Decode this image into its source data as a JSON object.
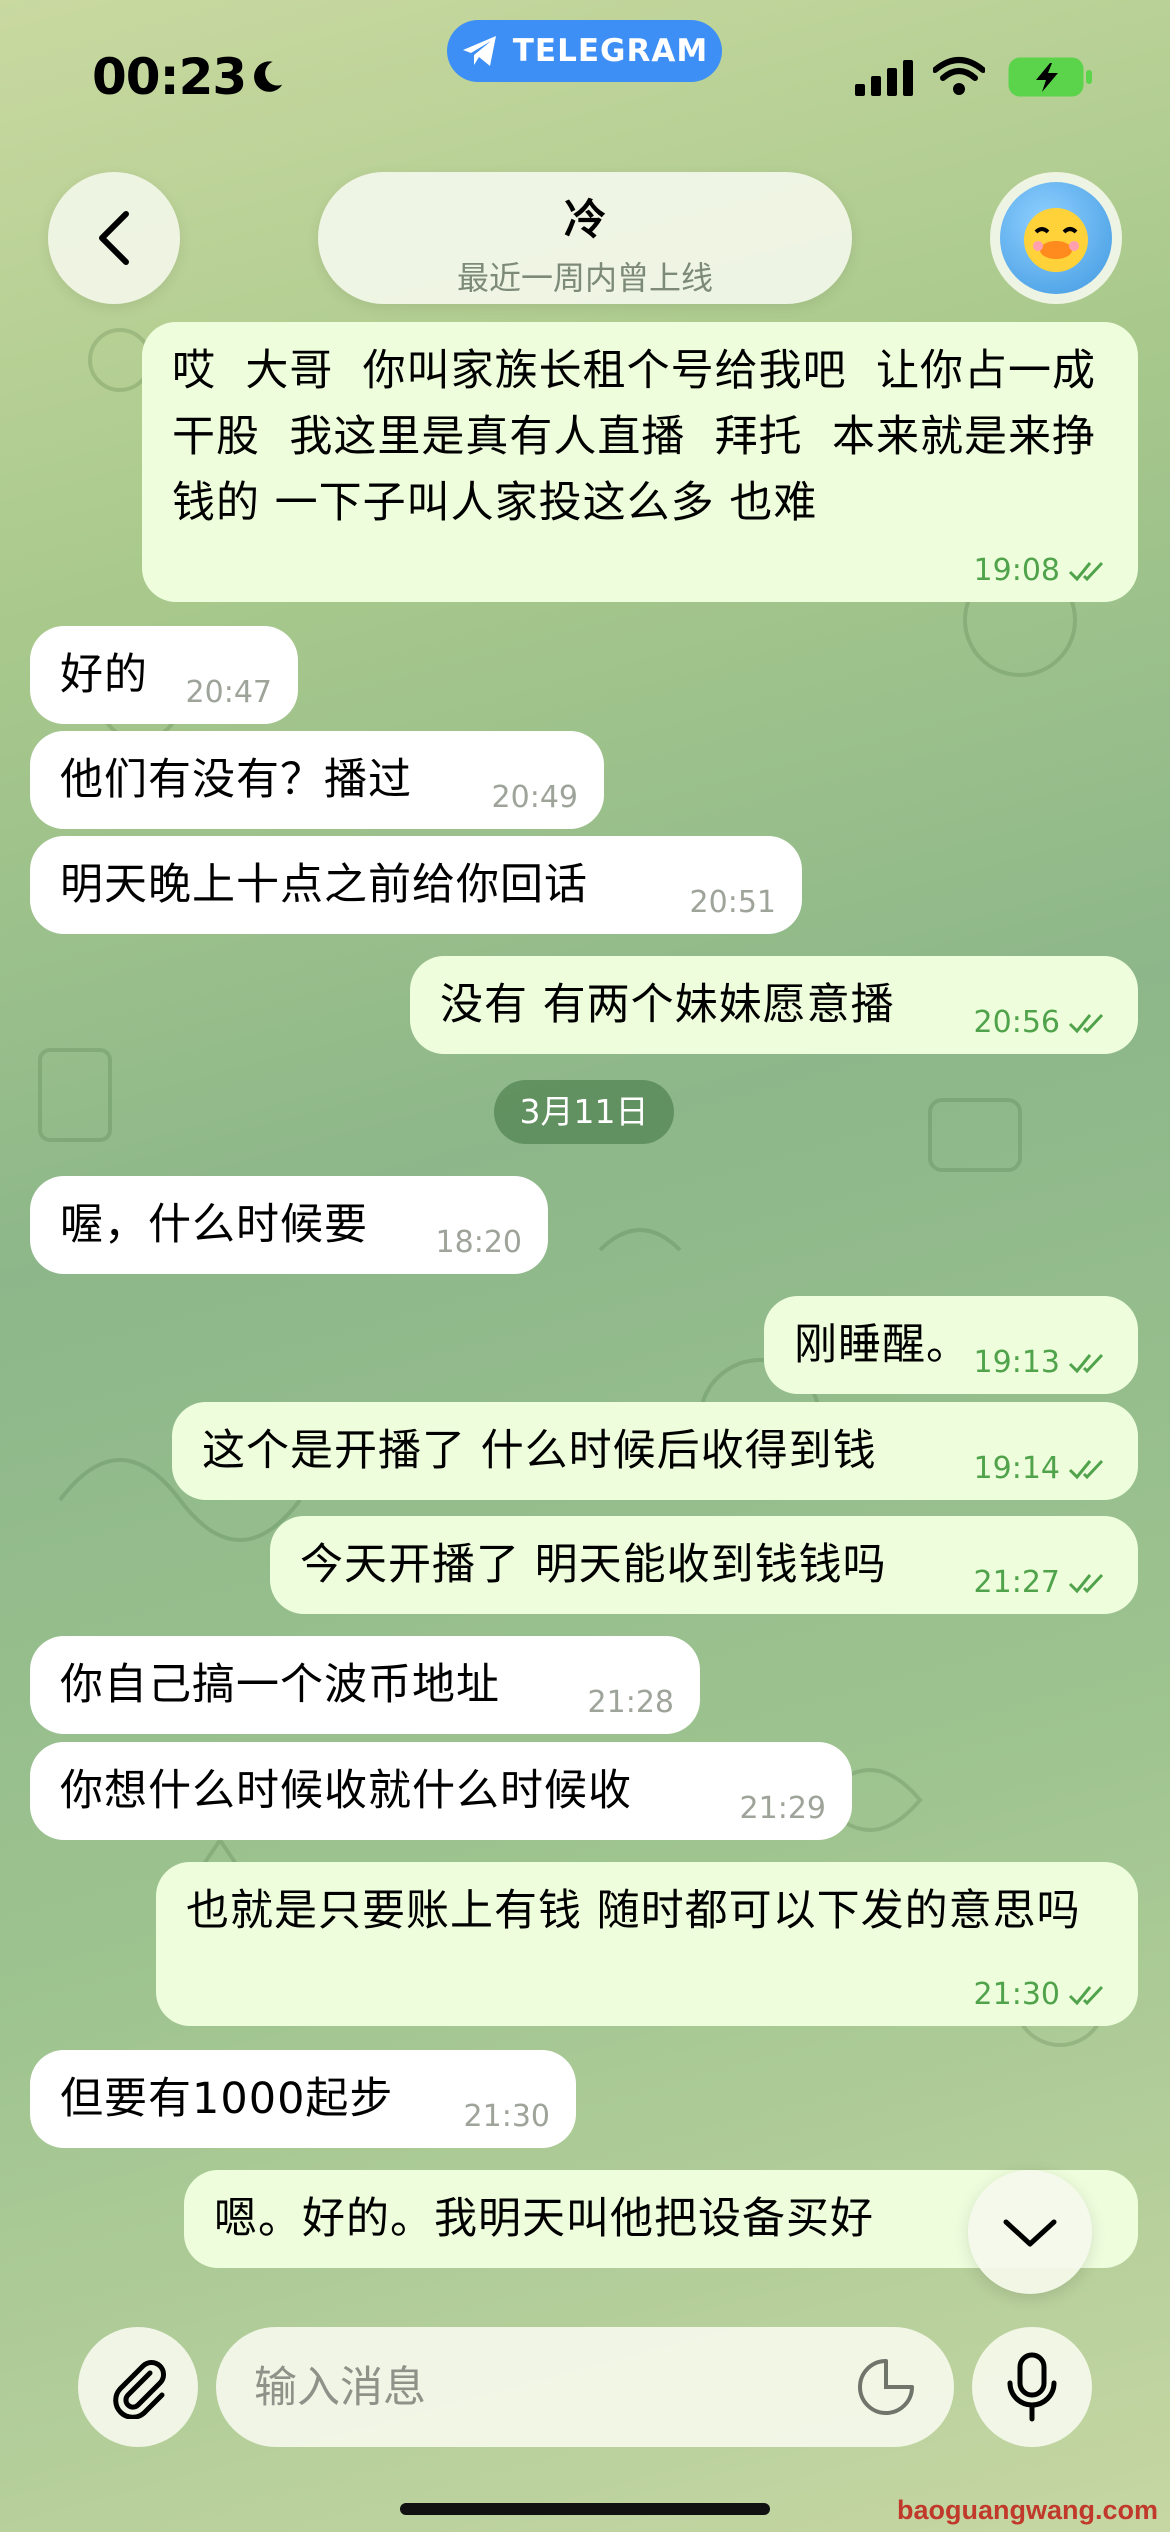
{
  "status_bar": {
    "time": "00:23",
    "app_badge": "TELEGRAM"
  },
  "header": {
    "title": "冷",
    "subtitle": "最近一周内曾上线"
  },
  "messages": [
    {
      "dir": "out",
      "text": "哎  大哥  你叫家族长租个号给我吧  让你占一成干股  我这里是真有人直播  拜托  本来就是来挣钱的 一下子叫人家投这么多 也难",
      "time": "19:08"
    },
    {
      "dir": "in",
      "text": "好的",
      "time": "20:47"
    },
    {
      "dir": "in",
      "text": "他们有没有？播过",
      "time": "20:49"
    },
    {
      "dir": "in",
      "text": "明天晚上十点之前给你回话",
      "time": "20:51"
    },
    {
      "dir": "out",
      "text": "没有 有两个妹妹愿意播",
      "time": "20:56"
    },
    {
      "dir": "in",
      "text": "喔，什么时候要",
      "time": "18:20"
    },
    {
      "dir": "out",
      "text": "刚睡醒。",
      "time": "19:13"
    },
    {
      "dir": "out",
      "text": "这个是开播了 什么时候后收得到钱",
      "time": "19:14"
    },
    {
      "dir": "out",
      "text": "今天开播了 明天能收到钱钱吗",
      "time": "21:27"
    },
    {
      "dir": "in",
      "text": "你自己搞一个波币地址",
      "time": "21:28"
    },
    {
      "dir": "in",
      "text": "你想什么时候收就什么时候收",
      "time": "21:29"
    },
    {
      "dir": "out",
      "text": "也就是只要账上有钱 随时都可以下发的意思吗",
      "time": "21:30"
    },
    {
      "dir": "in",
      "text": "但要有1000起步",
      "time": "21:30"
    },
    {
      "dir": "out",
      "text": "嗯。好的。我明天叫他把设备买好",
      "time": ""
    }
  ],
  "date_divider": "3月11日",
  "composer": {
    "placeholder": "输入消息"
  },
  "icons": {
    "back": "chevron-left-icon",
    "attach": "paperclip-icon",
    "sticker": "sticker-icon",
    "mic": "microphone-icon",
    "scroll_down": "chevron-down-icon",
    "read": "double-check-icon"
  },
  "colors": {
    "incoming": "#ffffff",
    "outgoing": "#eefedd",
    "time_out": "#50a34b",
    "badge": "#3d8ef5"
  },
  "watermark": "baoguangwang.com"
}
